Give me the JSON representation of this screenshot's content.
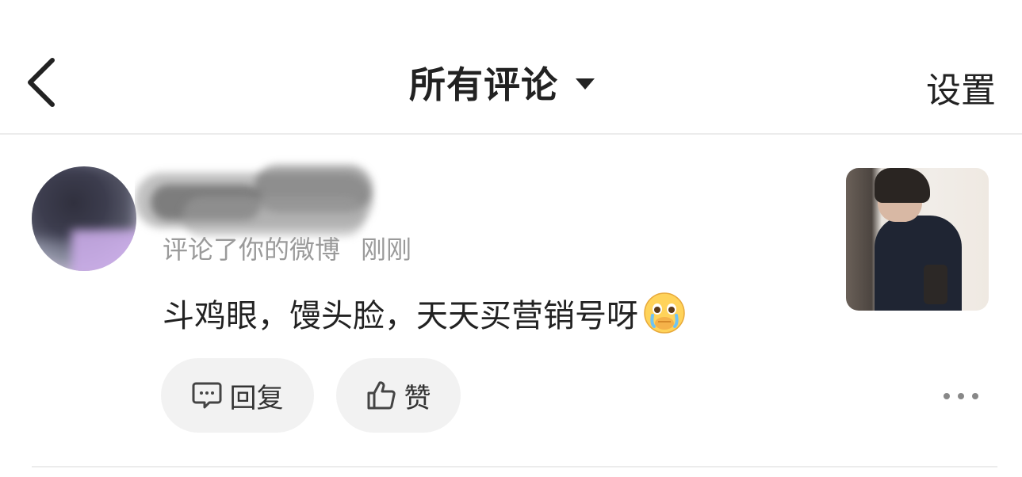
{
  "header": {
    "title": "所有评论",
    "settings_label": "设置",
    "back_icon": "chevron-left-icon",
    "dropdown_icon": "caret-down-icon"
  },
  "comment": {
    "meta": "评论了你的微博",
    "time": "刚刚",
    "text": "斗鸡眼，馒头脸，天天买营销号呀",
    "emoji": "crying-face-emoji",
    "reply_label": "回复",
    "like_label": "赞"
  }
}
